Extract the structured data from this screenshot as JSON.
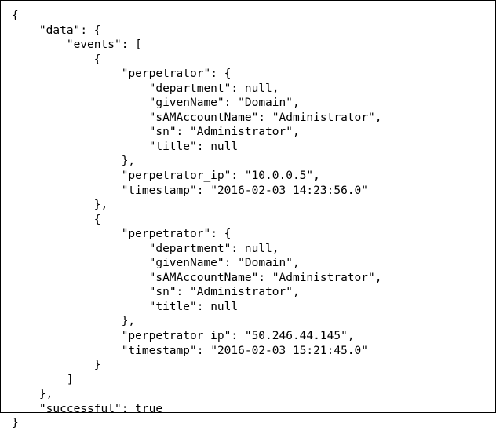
{
  "tokens": {
    "open_brace": "{",
    "close_brace": "}",
    "open_bracket": "[",
    "close_bracket": "]",
    "comma": ",",
    "colon_space": ": ",
    "quote": "\"",
    "null": "null",
    "true": "true"
  },
  "keys": {
    "data": "data",
    "events": "events",
    "perpetrator": "perpetrator",
    "department": "department",
    "givenName": "givenName",
    "sAMAccountName": "sAMAccountName",
    "sn": "sn",
    "title": "title",
    "perpetrator_ip": "perpetrator_ip",
    "timestamp": "timestamp",
    "successful": "successful"
  },
  "events": [
    {
      "ip": "10.0.0.5",
      "timestamp": "2016-02-03 14:23:56.0",
      "perpetrator": {
        "department": "null",
        "givenName": "Domain",
        "sAMAccountName": "Administrator",
        "sn": "Administrator",
        "title": "null"
      }
    },
    {
      "ip": "50.246.44.145",
      "timestamp": "2016-02-03 15:21:45.0",
      "perpetrator": {
        "department": "null",
        "givenName": "Domain",
        "sAMAccountName": "Administrator",
        "sn": "Administrator",
        "title": "null"
      }
    }
  ],
  "successful": "true"
}
